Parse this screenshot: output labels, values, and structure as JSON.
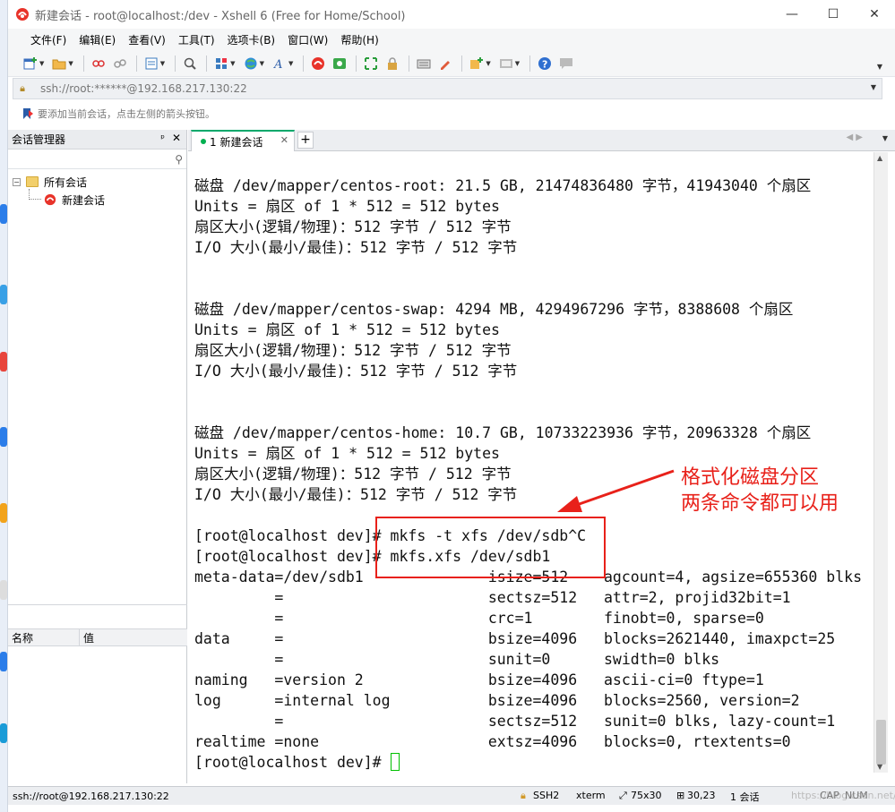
{
  "window": {
    "title": "新建会话 - root@localhost:/dev - Xshell 6 (Free for Home/School)",
    "minimize": "—",
    "maximize": "☐",
    "close": "✕"
  },
  "menu": [
    "文件(F)",
    "编辑(E)",
    "查看(V)",
    "工具(T)",
    "选项卡(B)",
    "窗口(W)",
    "帮助(H)"
  ],
  "address": {
    "text": "ssh://root:******@192.168.217.130:22",
    "lock_icon": "lock-icon"
  },
  "hint": "要添加当前会话，点击左侧的箭头按钮。",
  "session_manager": {
    "title": "会话管理器",
    "pin": "ᵖ",
    "close": "✕",
    "tree": {
      "folder": "所有会话",
      "expander": "−",
      "session": "新建会话"
    },
    "props": {
      "col_name": "名称",
      "col_value": "值"
    }
  },
  "tabs": {
    "active_label": "1 新建会话",
    "close": "✕",
    "add": "+"
  },
  "terminal": {
    "lines": [
      "磁盘 /dev/mapper/centos-root: 21.5 GB, 21474836480 字节，41943040 个扇区",
      "Units = 扇区 of 1 * 512 = 512 bytes",
      "扇区大小(逻辑/物理)：512 字节 / 512 字节",
      "I/O 大小(最小/最佳)：512 字节 / 512 字节",
      "",
      "",
      "磁盘 /dev/mapper/centos-swap: 4294 MB, 4294967296 字节，8388608 个扇区",
      "Units = 扇区 of 1 * 512 = 512 bytes",
      "扇区大小(逻辑/物理)：512 字节 / 512 字节",
      "I/O 大小(最小/最佳)：512 字节 / 512 字节",
      "",
      "",
      "磁盘 /dev/mapper/centos-home: 10.7 GB, 10733223936 字节，20963328 个扇区",
      "Units = 扇区 of 1 * 512 = 512 bytes",
      "扇区大小(逻辑/物理)：512 字节 / 512 字节",
      "I/O 大小(最小/最佳)：512 字节 / 512 字节",
      "",
      "[root@localhost dev]# mkfs -t xfs /dev/sdb^C",
      "[root@localhost dev]# mkfs.xfs /dev/sdb1",
      "meta-data=/dev/sdb1              isize=512    agcount=4, agsize=655360 blks",
      "         =                       sectsz=512   attr=2, projid32bit=1",
      "         =                       crc=1        finobt=0, sparse=0",
      "data     =                       bsize=4096   blocks=2621440, imaxpct=25",
      "         =                       sunit=0      swidth=0 blks",
      "naming   =version 2              bsize=4096   ascii-ci=0 ftype=1",
      "log      =internal log           bsize=4096   blocks=2560, version=2",
      "         =                       sectsz=512   sunit=0 blks, lazy-count=1",
      "realtime =none                   extsz=4096   blocks=0, rtextents=0"
    ],
    "prompt": "[root@localhost dev]# "
  },
  "annotation": {
    "line1": "格式化磁盘分区",
    "line2": "两条命令都可以用",
    "color": "#e8211a"
  },
  "status": {
    "connection": "ssh://root@192.168.217.130:22",
    "protocol": "SSH2",
    "term": "xterm",
    "size": "75x30",
    "pos": "30,23",
    "sessions": "1 会话",
    "caps": "CAP",
    "num": "NUM",
    "watermark": "https://blog.csdn.net/..."
  },
  "toolbar_icons": [
    "new-session-icon",
    "open-folder-icon",
    "reconnect-icon",
    "disconnect-icon",
    "properties-icon",
    "find-icon",
    "layout-icon",
    "globe-icon",
    "font-icon",
    "xshell-icon",
    "xftp-icon",
    "fullscreen-icon",
    "lock-icon",
    "keyboard-icon",
    "pen-icon",
    "new-tab-icon",
    "tile-icon",
    "help-icon",
    "chat-icon"
  ]
}
